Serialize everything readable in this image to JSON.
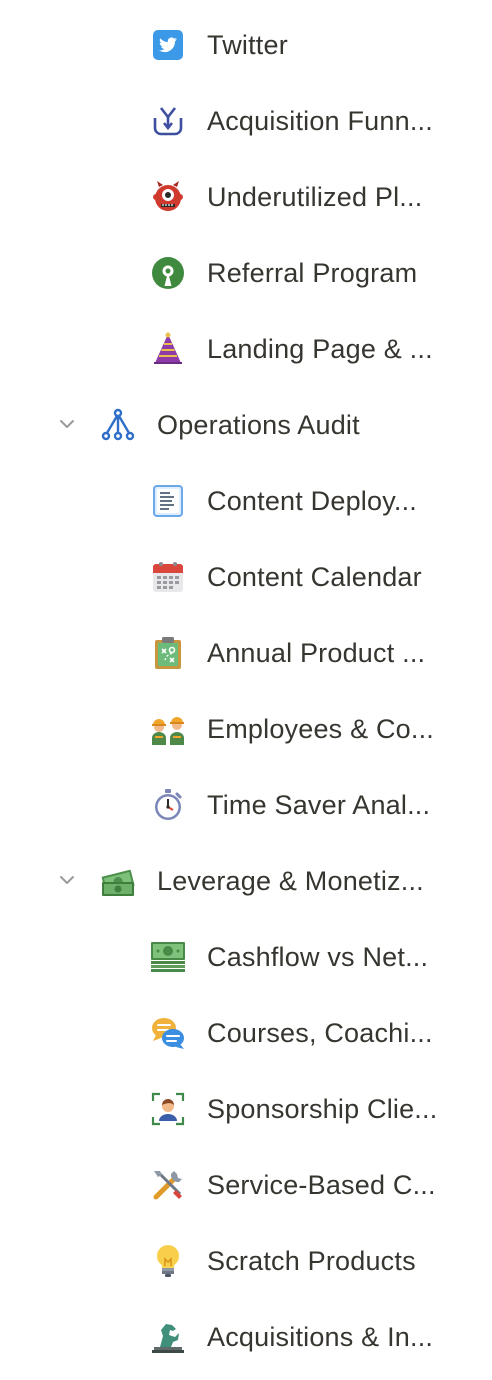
{
  "sidebar": {
    "items": [
      {
        "label": "Twitter",
        "icon": "twitter-icon"
      },
      {
        "label": "Acquisition Funn...",
        "icon": "funnel-icon"
      },
      {
        "label": "Underutilized Pl...",
        "icon": "red-monster-icon"
      },
      {
        "label": "Referral Program",
        "icon": "open-source-icon"
      },
      {
        "label": "Landing Page & ...",
        "icon": "party-hat-icon"
      },
      {
        "label": "Operations Audit",
        "icon": "hierarchy-icon",
        "expanded": true
      },
      {
        "label": "Content Deploy...",
        "icon": "document-icon"
      },
      {
        "label": "Content Calendar",
        "icon": "calendar-icon"
      },
      {
        "label": "Annual Product ...",
        "icon": "clipboard-icon"
      },
      {
        "label": "Employees & Co...",
        "icon": "workers-icon"
      },
      {
        "label": "Time Saver Anal...",
        "icon": "stopwatch-icon"
      },
      {
        "label": "Leverage & Monetiz...",
        "icon": "money-icon",
        "expanded": true
      },
      {
        "label": "Cashflow vs Net...",
        "icon": "money-stack-icon"
      },
      {
        "label": "Courses, Coachi...",
        "icon": "speech-bubbles-icon"
      },
      {
        "label": "Sponsorship Clie...",
        "icon": "user-focus-icon"
      },
      {
        "label": "Service-Based C...",
        "icon": "tools-icon"
      },
      {
        "label": "Scratch Products",
        "icon": "lightbulb-icon"
      },
      {
        "label": "Acquisitions & In...",
        "icon": "horse-statue-icon"
      }
    ]
  },
  "colors": {
    "text": "#37352f",
    "chevron": "#9b9a97",
    "accent_blue": "#1d9bf0"
  }
}
